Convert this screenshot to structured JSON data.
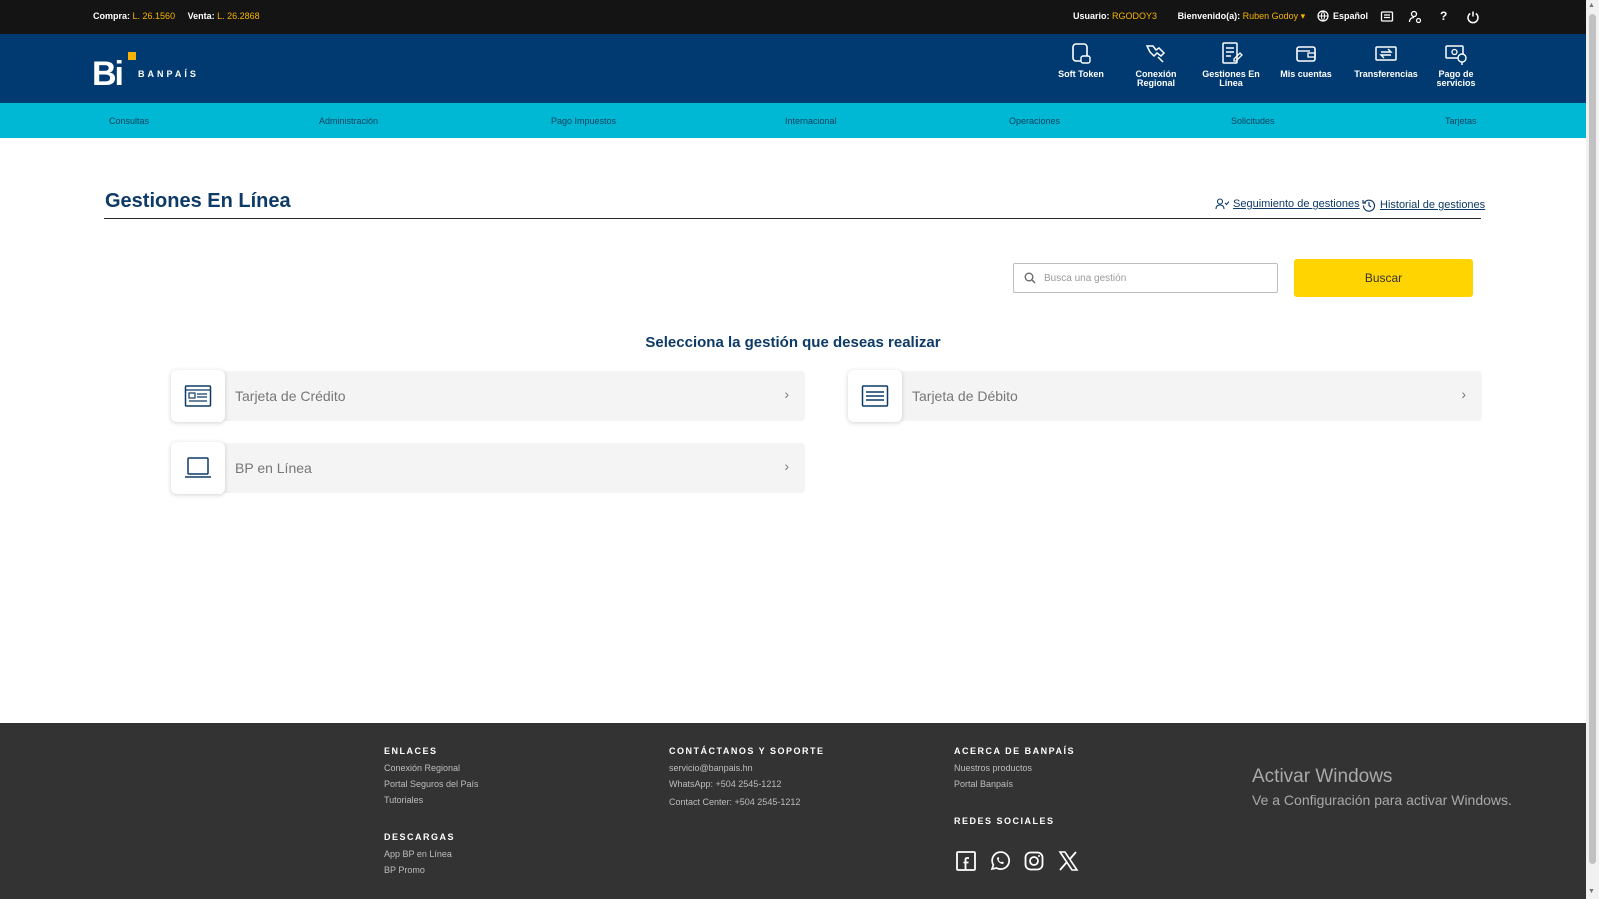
{
  "topbar": {
    "compra_label": "Compra:",
    "compra_value": "L. 26.1560",
    "venta_label": "Venta:",
    "venta_value": "L. 26.2868",
    "usuario_label": "Usuario:",
    "usuario_value": "RGODOY3",
    "bienvenido_label": "Bienvenido(a):",
    "bienvenido_value": "Ruben Godoy ▾",
    "language": "Español",
    "help": "?"
  },
  "logo": {
    "mark": "Bi",
    "name": "BANPAÍS"
  },
  "header_nav": [
    {
      "label": "Soft Token",
      "icon": "soft-token-icon"
    },
    {
      "label": "Conexión Regional",
      "icon": "conexion-regional-icon"
    },
    {
      "label": "Gestiones En Línea",
      "icon": "gestiones-icon"
    },
    {
      "label": "Mis cuentas",
      "icon": "wallet-icon"
    },
    {
      "label": "Transferencias",
      "icon": "transfer-icon"
    },
    {
      "label": "Pago de servicios",
      "icon": "payment-icon"
    }
  ],
  "menu": [
    "Consultas",
    "Administración",
    "Pago Impuestos",
    "Internacional",
    "Operaciones",
    "Solicitudes",
    "Tarjetas"
  ],
  "page": {
    "title": "Gestiones En Línea",
    "link_seguimiento": "Seguimiento de gestiones",
    "link_historial": "Historial de gestiones",
    "search_placeholder": "Busca una gestión",
    "search_button": "Buscar",
    "subtitle": "Selecciona la gestión que deseas realizar"
  },
  "cards": [
    {
      "label": "Tarjeta de Crédito",
      "icon": "credit-card-icon"
    },
    {
      "label": "Tarjeta de Débito",
      "icon": "debit-card-icon"
    },
    {
      "label": "BP en Línea",
      "icon": "laptop-icon"
    }
  ],
  "footer": {
    "enlaces_title": "ENLACES",
    "enlaces": [
      "Conexión Regional",
      "Portal Seguros del País",
      "Tutoriales"
    ],
    "descargas_title": "DESCARGAS",
    "descargas": [
      "App BP en Línea",
      "BP Promo"
    ],
    "contacto_title": "CONTÁCTANOS Y SOPORTE",
    "contacto": [
      "servicio@banpais.hn",
      "WhatsApp: +504 2545-1212",
      "Contact Center: +504 2545-1212"
    ],
    "acerca_title": "ACERCA DE BANPAÍS",
    "acerca": [
      "Nuestros productos",
      "Portal Banpaís"
    ],
    "redes_title": "REDES SOCIALES",
    "redes": [
      "facebook-icon",
      "whatsapp-icon",
      "instagram-icon",
      "x-icon"
    ]
  },
  "watermark": {
    "line1": "Activar Windows",
    "line2": "Ve a Configuración para activar Windows."
  },
  "colors": {
    "topbar": "#141414",
    "header": "#003a70",
    "menu": "#00b8d4",
    "accent": "#f5b400",
    "button": "#ffd400",
    "footer": "#333333"
  }
}
